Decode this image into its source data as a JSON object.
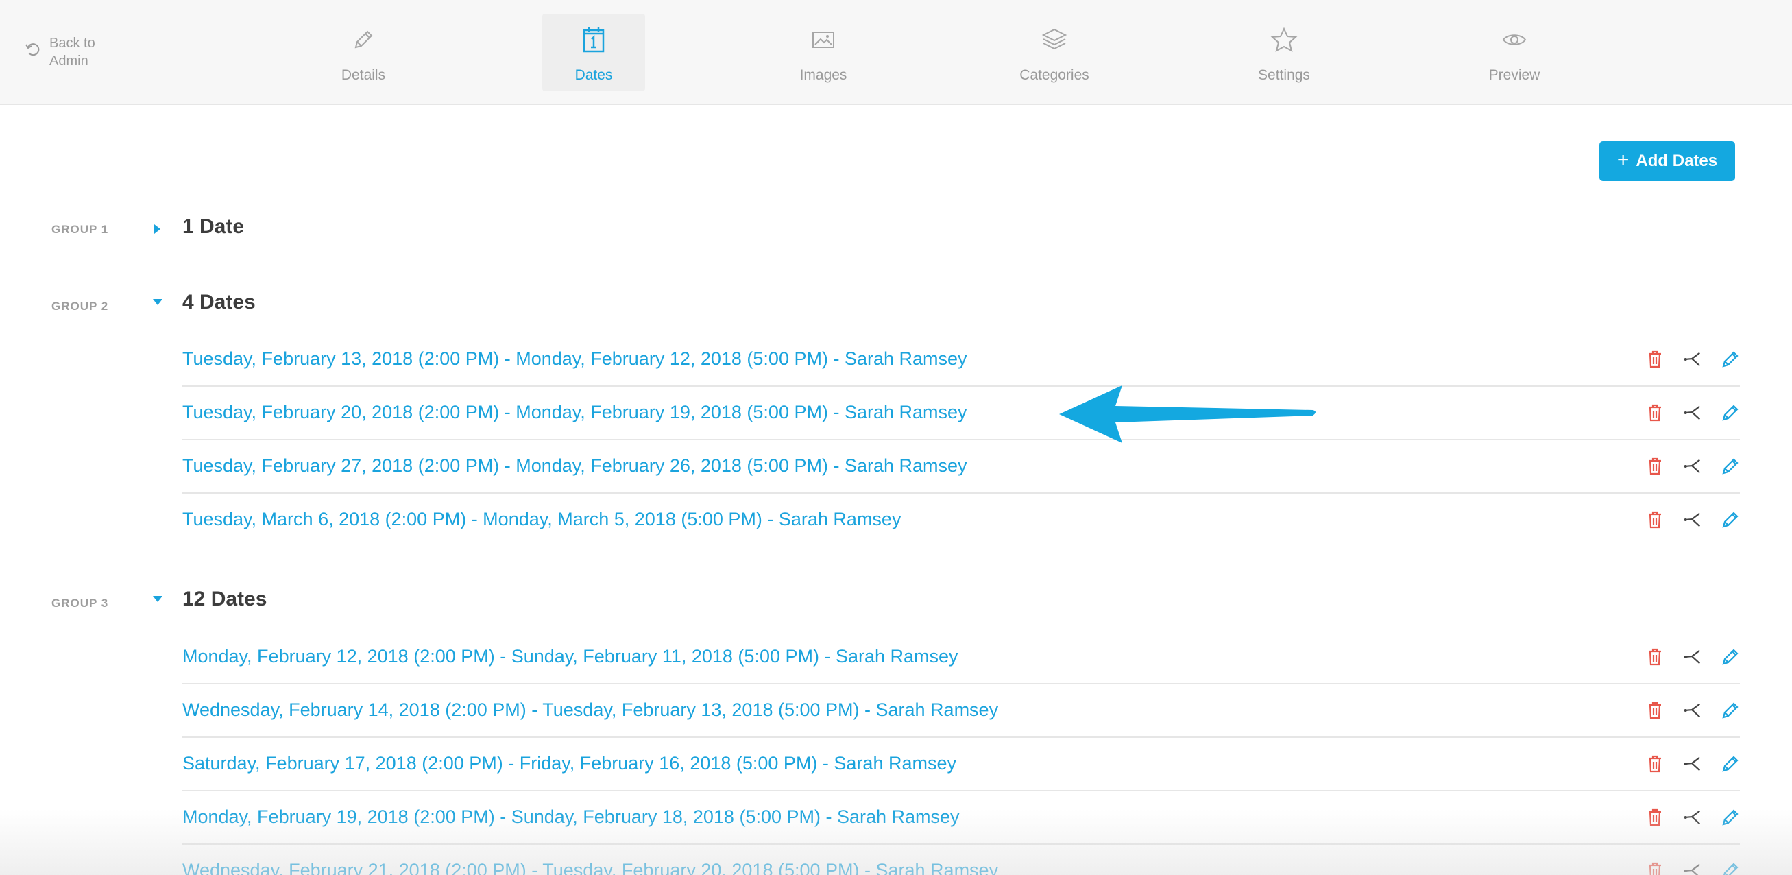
{
  "nav": {
    "back_label": "Back to Admin",
    "tabs": [
      {
        "label": "Details",
        "icon": "pencil-icon",
        "active": false
      },
      {
        "label": "Dates",
        "icon": "calendar-icon",
        "active": true
      },
      {
        "label": "Images",
        "icon": "image-icon",
        "active": false
      },
      {
        "label": "Categories",
        "icon": "layers-icon",
        "active": false
      },
      {
        "label": "Settings",
        "icon": "star-icon",
        "active": false
      },
      {
        "label": "Preview",
        "icon": "eye-icon",
        "active": false
      }
    ]
  },
  "add_dates_label": "Add Dates",
  "colors": {
    "accent": "#1aa3dd",
    "button": "#14a8e0",
    "delete": "#e8574b",
    "share": "#444444"
  },
  "groups": [
    {
      "label": "GROUP 1",
      "title": "1 Date",
      "expanded": false,
      "dates": []
    },
    {
      "label": "GROUP 2",
      "title": "4 Dates",
      "expanded": true,
      "dates": [
        "Tuesday, February 13, 2018 (2:00 PM) - Monday, February 12, 2018 (5:00 PM) - Sarah Ramsey",
        "Tuesday, February 20, 2018 (2:00 PM) - Monday, February 19, 2018 (5:00 PM) - Sarah Ramsey",
        "Tuesday, February 27, 2018 (2:00 PM) - Monday, February 26, 2018 (5:00 PM) - Sarah Ramsey",
        "Tuesday, March 6, 2018 (2:00 PM) - Monday, March 5, 2018 (5:00 PM) - Sarah Ramsey"
      ]
    },
    {
      "label": "GROUP 3",
      "title": "12 Dates",
      "expanded": true,
      "dates": [
        "Monday, February 12, 2018 (2:00 PM) - Sunday, February 11, 2018 (5:00 PM) - Sarah Ramsey",
        "Wednesday, February 14, 2018 (2:00 PM) - Tuesday, February 13, 2018 (5:00 PM) - Sarah Ramsey",
        "Saturday, February 17, 2018 (2:00 PM) - Friday, February 16, 2018 (5:00 PM) - Sarah Ramsey",
        "Monday, February 19, 2018 (2:00 PM) - Sunday, February 18, 2018 (5:00 PM) - Sarah Ramsey",
        "Wednesday, February 21, 2018 (2:00 PM) - Tuesday, February 20, 2018 (5:00 PM) - Sarah Ramsey"
      ]
    }
  ],
  "annotation": {
    "icon": "arrow-left-icon",
    "target": "Tuesday, February 20, 2018 (2:00 PM) - Monday, February 19, 2018 (5:00 PM) - Sarah Ramsey"
  }
}
